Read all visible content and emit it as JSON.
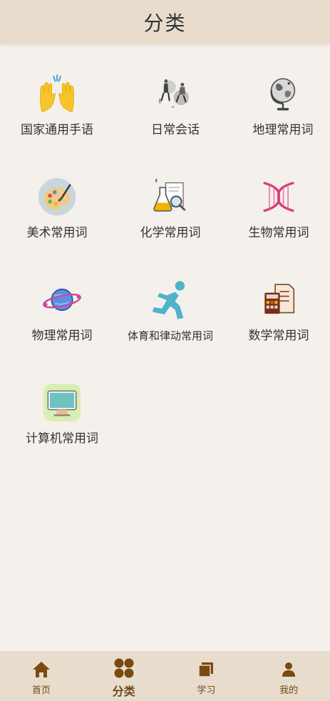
{
  "header": {
    "title": "分类"
  },
  "categories": [
    {
      "label": "国家通用手语",
      "icon": "raised-hands-icon"
    },
    {
      "label": "日常会话",
      "icon": "conversation-icon"
    },
    {
      "label": "地理常用词",
      "icon": "globe-icon"
    },
    {
      "label": "美术常用词",
      "icon": "palette-icon"
    },
    {
      "label": "化学常用词",
      "icon": "flask-icon"
    },
    {
      "label": "生物常用词",
      "icon": "dna-icon"
    },
    {
      "label": "物理常用词",
      "icon": "planet-icon"
    },
    {
      "label": "体育和律动常用词",
      "icon": "runner-icon"
    },
    {
      "label": "数学常用词",
      "icon": "calculator-icon"
    },
    {
      "label": "计算机常用词",
      "icon": "computer-icon"
    }
  ],
  "bottom_nav": {
    "items": [
      {
        "label": "首页",
        "icon": "home-icon"
      },
      {
        "label": "分类",
        "icon": "category-icon",
        "active": true
      },
      {
        "label": "学习",
        "icon": "study-icon"
      },
      {
        "label": "我的",
        "icon": "user-icon"
      }
    ]
  },
  "colors": {
    "header_bg": "#e8ddcd",
    "page_bg": "#f4f1ec",
    "nav_accent": "#6b4a1c"
  }
}
